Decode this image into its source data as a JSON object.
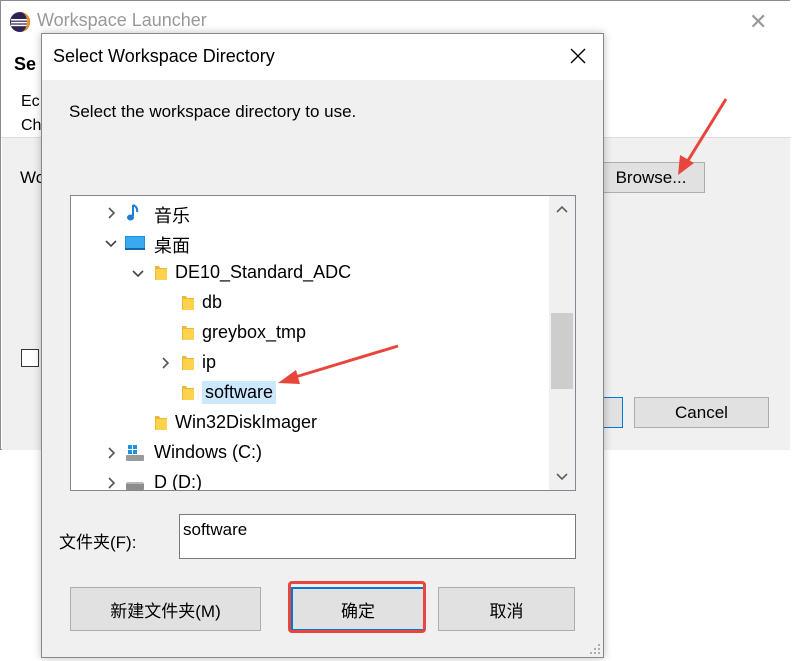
{
  "background_window": {
    "title": "Workspace Launcher",
    "header_text": "Se",
    "desc_line1": "Ec",
    "desc_line2": "Ch",
    "workspace_label": "Wo",
    "browse_label": "Browse...",
    "cancel_label": "Cancel"
  },
  "dialog": {
    "title": "Select Workspace Directory",
    "prompt": "Select the workspace directory to use.",
    "tree": [
      {
        "label": "音乐",
        "icon": "music-note-icon",
        "expander": "collapsed"
      },
      {
        "label": "桌面",
        "icon": "desktop-icon",
        "expander": "expanded"
      },
      {
        "label": "DE10_Standard_ADC",
        "icon": "folder-icon",
        "expander": "expanded"
      },
      {
        "label": "db",
        "icon": "folder-icon",
        "expander": "none"
      },
      {
        "label": "greybox_tmp",
        "icon": "folder-icon",
        "expander": "none"
      },
      {
        "label": "ip",
        "icon": "folder-icon",
        "expander": "collapsed"
      },
      {
        "label": "software",
        "icon": "folder-icon",
        "expander": "none",
        "selected": true
      },
      {
        "label": "Win32DiskImager",
        "icon": "folder-icon",
        "expander": "none"
      },
      {
        "label": "Windows (C:)",
        "icon": "windows-drive-icon",
        "expander": "collapsed"
      },
      {
        "label": "D (D:)",
        "icon": "drive-icon",
        "expander": "collapsed"
      }
    ],
    "folder_label": "文件夹(F):",
    "folder_value": "software",
    "new_folder_button": "新建文件夹(M)",
    "ok_button": "确定",
    "cancel_button": "取消"
  },
  "colors": {
    "annotation_red": "#e8453c",
    "selection": "#cce8ff",
    "focus_blue": "#0078d7"
  }
}
